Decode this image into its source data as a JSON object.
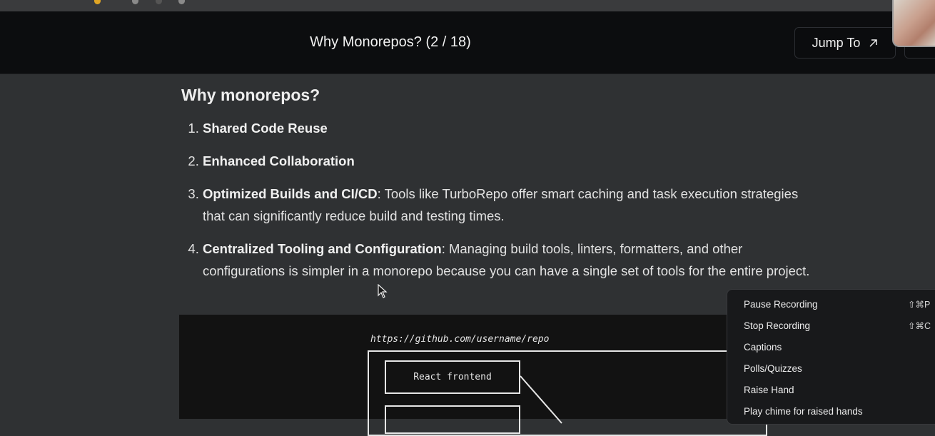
{
  "header": {
    "title": "Why Monorepos? (2 / 18)",
    "jump_button": "Jump To"
  },
  "content": {
    "heading": "Why monorepos?",
    "items": [
      {
        "bold": "Shared Code Reuse",
        "text": ""
      },
      {
        "bold": "Enhanced Collaboration",
        "text": ""
      },
      {
        "bold": "Optimized Builds and CI/CD",
        "text": ": Tools like TurboRepo offer smart caching and task execution strategies that can significantly reduce build and testing times."
      },
      {
        "bold": "Centralized Tooling and Configuration",
        "text": ": Managing build tools, linters, formatters, and other configurations is simpler in a monorepo because you can have a single set of tools for the entire project."
      }
    ]
  },
  "diagram": {
    "url": "https://github.com/username/repo",
    "box_label": "React frontend"
  },
  "recording_menu": {
    "items": [
      {
        "label": "Pause Recording",
        "shortcut": "⇧⌘P"
      },
      {
        "label": "Stop Recording",
        "shortcut": "⇧⌘C"
      },
      {
        "label": "Captions",
        "shortcut": ""
      },
      {
        "label": "Polls/Quizzes",
        "shortcut": ""
      },
      {
        "label": "Raise Hand",
        "shortcut": ""
      },
      {
        "label": "Play chime for raised hands",
        "shortcut": ""
      }
    ]
  }
}
